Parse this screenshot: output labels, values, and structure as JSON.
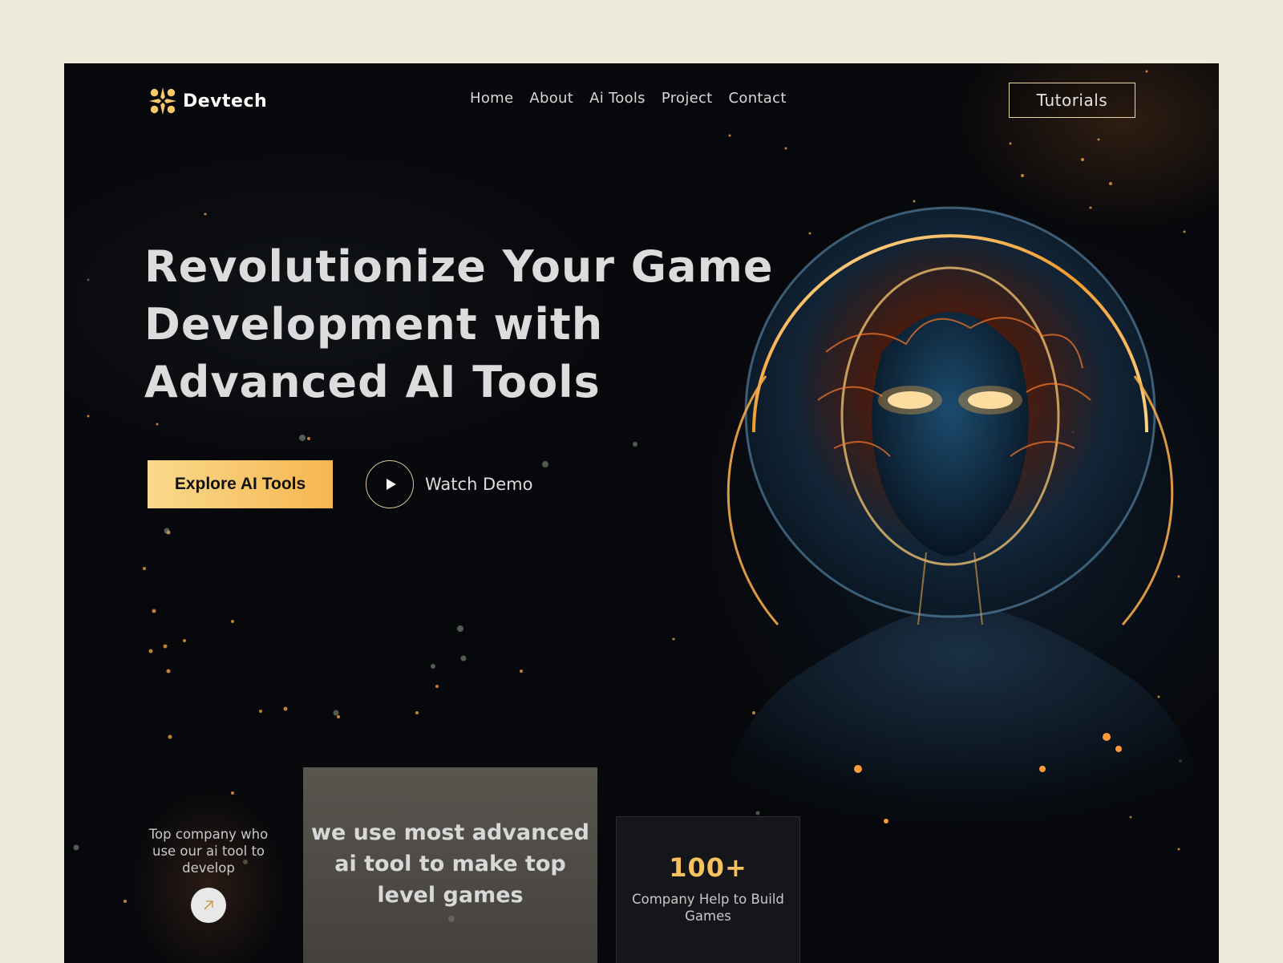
{
  "brand": {
    "name": "Devtech",
    "accent": "#f6b651"
  },
  "nav": {
    "items": [
      {
        "label": "Home"
      },
      {
        "label": "About"
      },
      {
        "label": "Ai Tools"
      },
      {
        "label": "Project"
      },
      {
        "label": "Contact"
      }
    ],
    "cta_label": "Tutorials"
  },
  "hero": {
    "title_lines": [
      "Revolutionize Your Game",
      "Development with",
      "Advanced AI Tools"
    ],
    "primary_label": "Explore AI Tools",
    "secondary_label": "Watch Demo"
  },
  "cards": {
    "left_text": "Top company who use our ai tool to develop",
    "middle_text": "we use most advanced ai tool to make top level games",
    "stat_value": "100+",
    "stat_label": "Company Help to Build Games"
  },
  "icons": {
    "logo": "sparkle-logo-icon",
    "play": "play-icon",
    "arrow": "arrow-up-right-icon"
  }
}
